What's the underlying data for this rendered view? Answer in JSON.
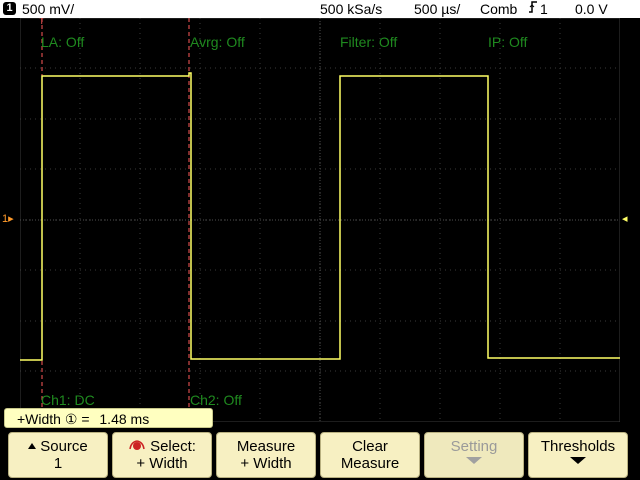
{
  "status_bar": {
    "channel": "1",
    "volts_div": "500 mV/",
    "sample_rate": "500 kSa/s",
    "time_div": "500 µs/",
    "trigger_mode": "Comb",
    "trigger_source": "1",
    "trigger_level": "0.0 V"
  },
  "overlays": {
    "la": "LA: Off",
    "avrg": "Avrg: Off",
    "filter": "Filter: Off",
    "ip": "IP: Off",
    "ch1": "Ch1: DC",
    "ch2": "Ch2: Off"
  },
  "readout": {
    "label": "+Width",
    "channel": "①",
    "value": "1.48 ms"
  },
  "softkeys": {
    "source": {
      "line1": "Source",
      "line2": "1"
    },
    "select": {
      "line1": "Select:",
      "line2": "+ Width"
    },
    "measure": {
      "line1": "Measure",
      "line2": "+ Width"
    },
    "clear": {
      "line1": "Clear",
      "line2": "Measure"
    },
    "setting": {
      "line1": "Setting"
    },
    "thresholds": {
      "line1": "Thresholds"
    }
  },
  "colors": {
    "trace": "#ffff66",
    "grid": "#3a3a3a",
    "cursor": "#ff5a5a",
    "overlay_text": "#1f8a1f",
    "softkey_bg": "#f7f0c2"
  },
  "icons": {
    "trigger_edge": "rising-edge-icon",
    "entry_knob": "entry-knob-icon"
  }
}
